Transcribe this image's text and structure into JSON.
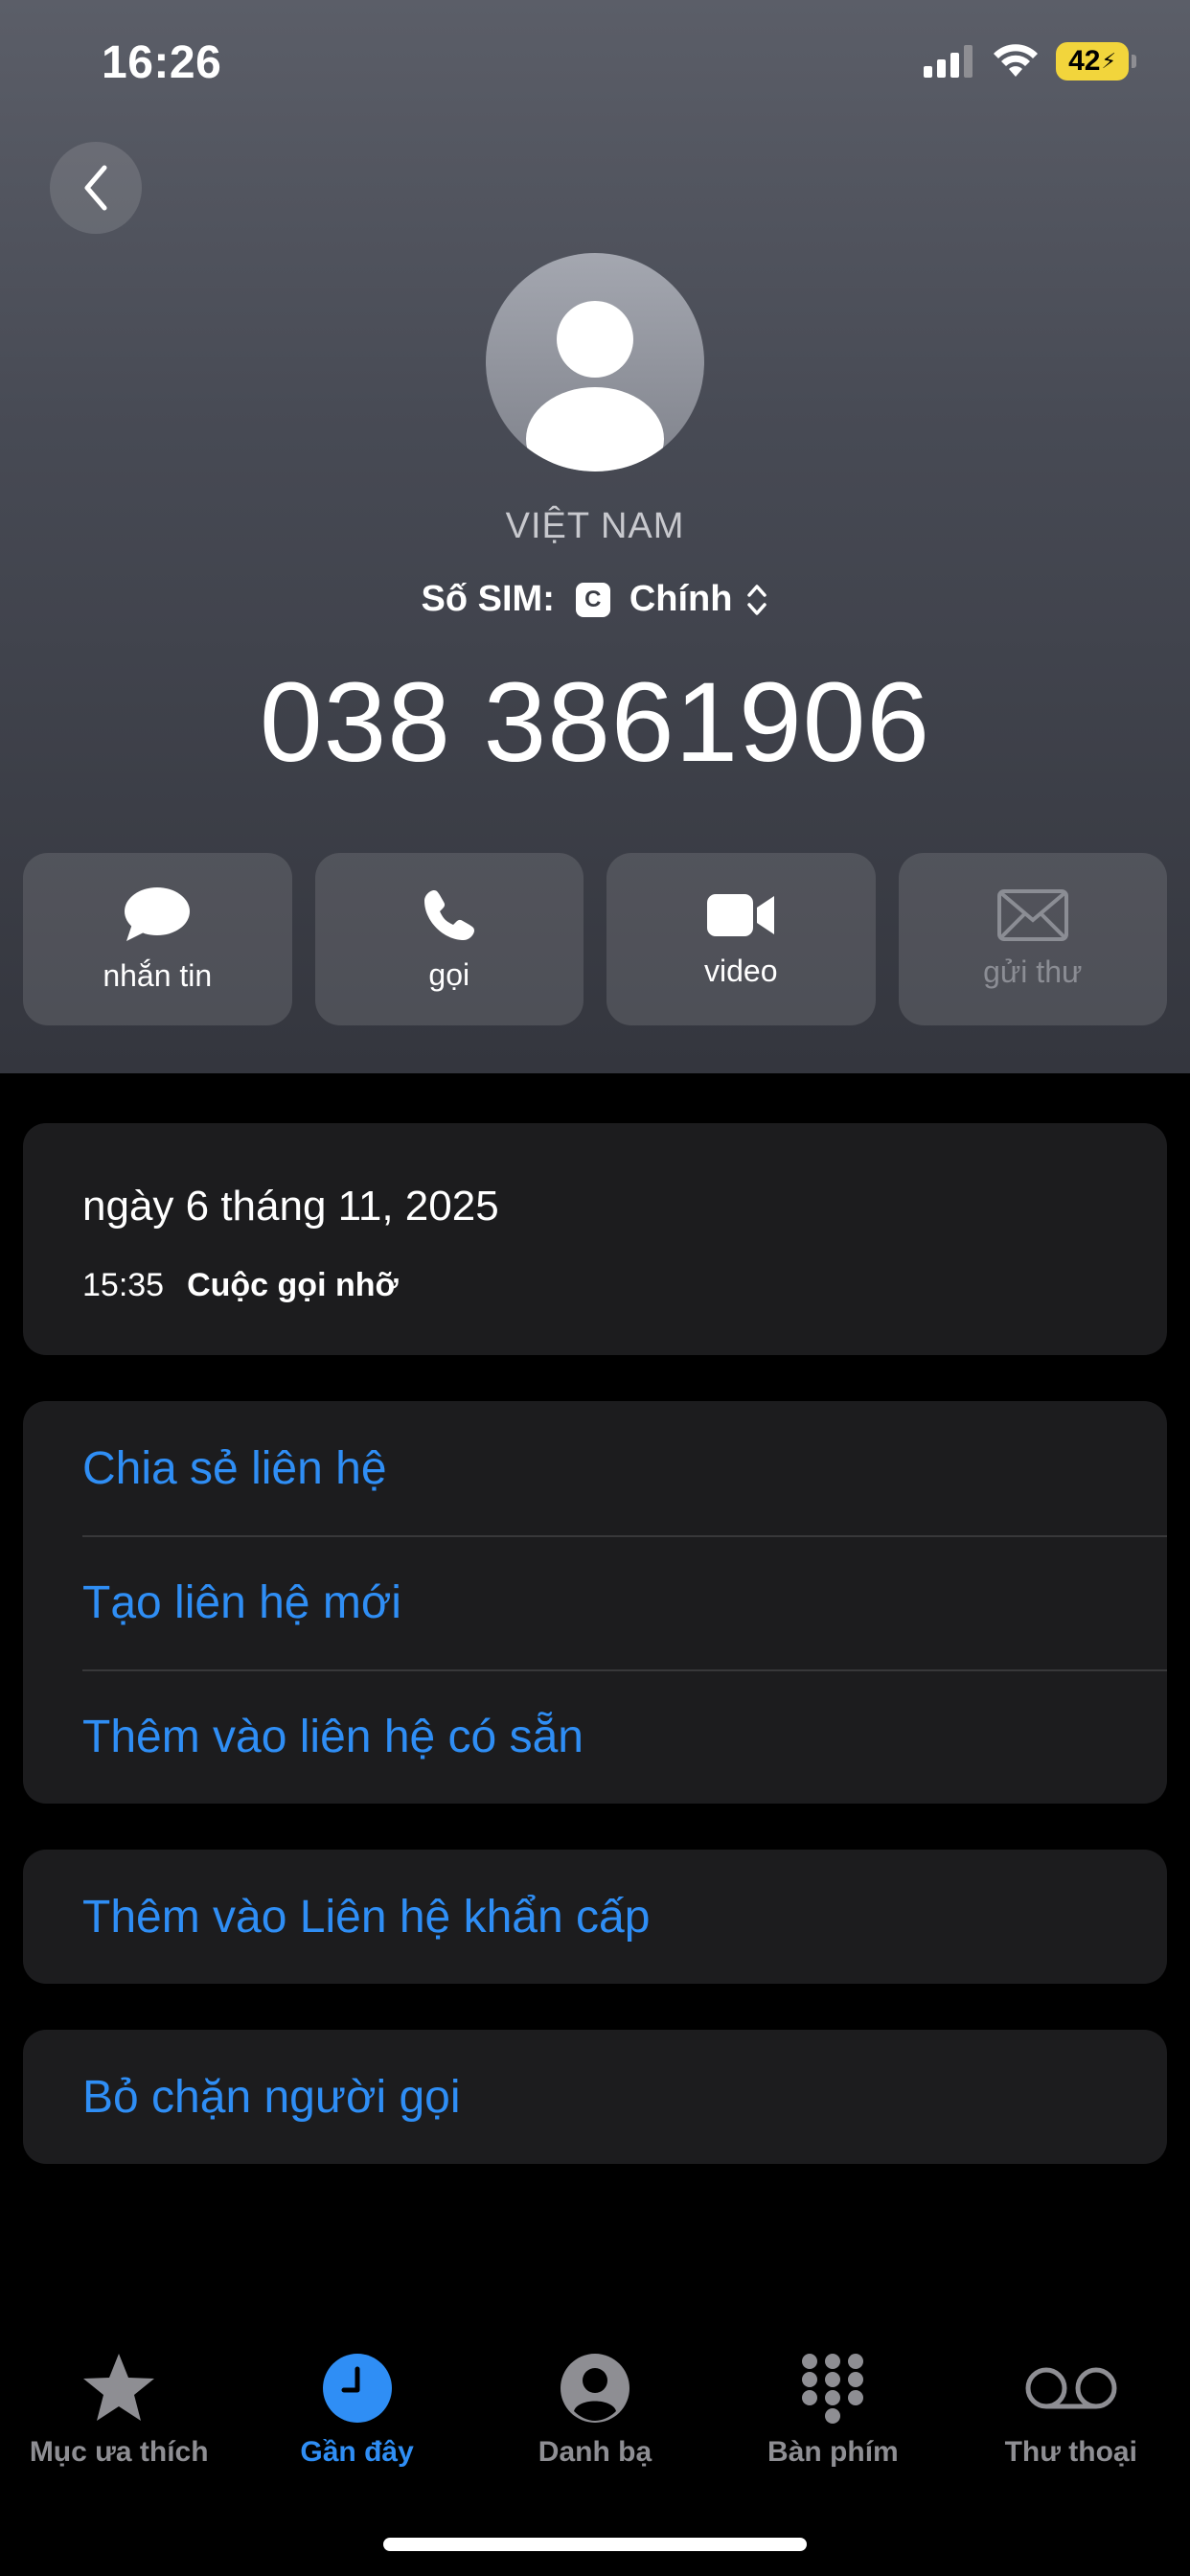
{
  "status": {
    "time": "16:26",
    "battery": "42"
  },
  "contact": {
    "country": "VIỆT NAM",
    "sim_label": "Số SIM:",
    "sim_badge": "C",
    "sim_value": "Chính",
    "phone_number": "038 3861906"
  },
  "actions": [
    {
      "label": "nhắn tin",
      "icon": "message-bubble-icon",
      "enabled": true
    },
    {
      "label": "gọi",
      "icon": "phone-icon",
      "enabled": true
    },
    {
      "label": "video",
      "icon": "video-camera-icon",
      "enabled": true
    },
    {
      "label": "gửi thư",
      "icon": "envelope-icon",
      "enabled": false
    }
  ],
  "recent": {
    "date": "ngày 6 tháng 11, 2025",
    "time": "15:35",
    "type": "Cuộc gọi nhỡ"
  },
  "options": [
    "Chia sẻ liên hệ",
    "Tạo liên hệ mới",
    "Thêm vào liên hệ có sẵn"
  ],
  "emergency_label": "Thêm vào Liên hệ khẩn cấp",
  "unblock_label": "Bỏ chặn người gọi",
  "tabs": [
    {
      "label": "Mục ưa thích",
      "icon": "star-icon",
      "active": false
    },
    {
      "label": "Gần đây",
      "icon": "clock-icon",
      "active": true
    },
    {
      "label": "Danh bạ",
      "icon": "person-circle-icon",
      "active": false
    },
    {
      "label": "Bàn phím",
      "icon": "keypad-icon",
      "active": false
    },
    {
      "label": "Thư thoại",
      "icon": "voicemail-icon",
      "active": false
    }
  ],
  "colors": {
    "accent": "#2f8ef5",
    "card": "#1c1c1e",
    "battery": "#f2d53c"
  }
}
